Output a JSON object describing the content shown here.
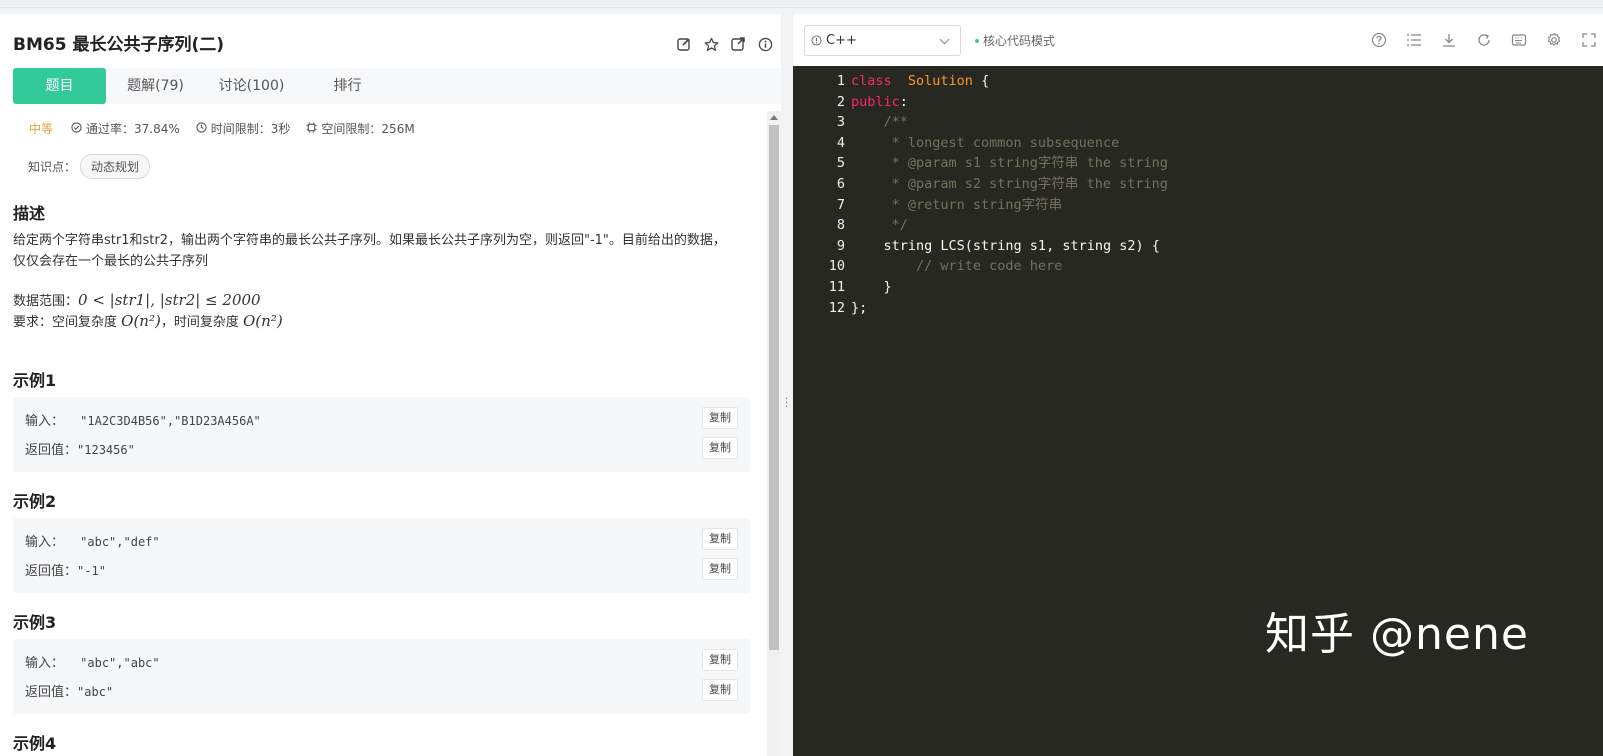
{
  "problem": {
    "title": "BM65  最长公共子序列(二)",
    "tabs": [
      {
        "label": "题目"
      },
      {
        "label": "题解(79)"
      },
      {
        "label": "讨论(100)"
      },
      {
        "label": "排行"
      }
    ],
    "difficulty": "中等",
    "pass_rate": "通过率：37.84%",
    "time_limit": "时间限制：3秒",
    "space_limit": "空间限制：256M",
    "knowledge_label": "知识点：",
    "knowledge_tag": "动态规划",
    "desc_heading": "描述",
    "desc_text": "给定两个字符串str1和str2，输出两个字符串的最长公共子序列。如果最长公共子序列为空，则返回\"-1\"。目前给出的数据，仅仅会存在一个最长的公共子序列",
    "range_label": "数据范围：",
    "range_math": "0 < |str1|, |str2| ≤ 2000",
    "req_label": "要求：空间复杂度",
    "req_space": "O(n²)",
    "req_sep": "，时间复杂度",
    "req_time": "O(n²)",
    "examples": [
      {
        "heading": "示例1",
        "input_label": "输入：",
        "input": "\"1A2C3D4B56\",\"B1D23A456A\"",
        "output_label": "返回值：",
        "output": "\"123456\"",
        "copy": "复制"
      },
      {
        "heading": "示例2",
        "input_label": "输入：",
        "input": "\"abc\",\"def\"",
        "output_label": "返回值：",
        "output": "\"-1\"",
        "copy": "复制"
      },
      {
        "heading": "示例3",
        "input_label": "输入：",
        "input": "\"abc\",\"abc\"",
        "output_label": "返回值：",
        "output": "\"abc\"",
        "copy": "复制"
      }
    ],
    "next_heading": "示例4"
  },
  "editor": {
    "language": "C++",
    "mode": "核心代码模式",
    "lines": [
      {
        "n": "1",
        "parts": [
          [
            "kw",
            "class"
          ],
          [
            "",
            "  "
          ],
          [
            "cls",
            "Solution"
          ],
          [
            "",
            " {"
          ]
        ]
      },
      {
        "n": "2",
        "parts": [
          [
            "kw",
            "public"
          ],
          [
            "",
            ":"
          ]
        ]
      },
      {
        "n": "3",
        "parts": [
          [
            "cm",
            "    /**"
          ]
        ]
      },
      {
        "n": "4",
        "parts": [
          [
            "cm",
            "     * longest common subsequence"
          ]
        ]
      },
      {
        "n": "5",
        "parts": [
          [
            "cm",
            "     * @param s1 string字符串 the string"
          ]
        ]
      },
      {
        "n": "6",
        "parts": [
          [
            "cm",
            "     * @param s2 string字符串 the string"
          ]
        ]
      },
      {
        "n": "7",
        "parts": [
          [
            "cm",
            "     * @return string字符串"
          ]
        ]
      },
      {
        "n": "8",
        "parts": [
          [
            "cm",
            "     */"
          ]
        ]
      },
      {
        "n": "9",
        "parts": [
          [
            "",
            "    string LCS(string s1, string s2) {"
          ]
        ]
      },
      {
        "n": "10",
        "parts": [
          [
            "cm",
            "        // write code here"
          ]
        ]
      },
      {
        "n": "11",
        "parts": [
          [
            "",
            "    }"
          ]
        ]
      },
      {
        "n": "12",
        "parts": [
          [
            "",
            "};"
          ]
        ]
      }
    ]
  },
  "watermark": "知乎 @nene",
  "colors": {
    "accent": "#32ca99",
    "difficulty": "#e6a23c",
    "editor_bg": "#272822",
    "keyword": "#f92672",
    "class": "#fd971f",
    "comment": "#75715e"
  }
}
